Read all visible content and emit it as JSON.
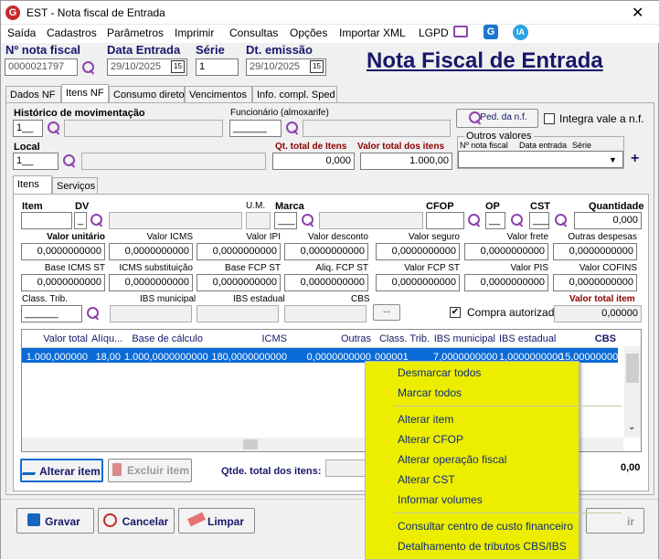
{
  "window": {
    "title": "EST - Nota fiscal de Entrada",
    "close": "✕"
  },
  "menu": {
    "items": [
      "Saída",
      "Cadastros",
      "Parâmetros",
      "Imprimir",
      "Consultas",
      "Opções",
      "Importar XML",
      "LGPD"
    ],
    "ia": "IA"
  },
  "header": {
    "nota_label": "Nº nota fiscal",
    "nota_value": "0000021797",
    "data_label": "Data Entrada",
    "data_value": "29/10/2025",
    "serie_label": "Série",
    "serie_value": "1",
    "emissao_label": "Dt. emissão",
    "emissao_value": "29/10/2025",
    "cal_icon": "15",
    "big_title": "Nota Fiscal de Entrada"
  },
  "tabs": [
    "Dados NF",
    "Itens NF",
    "Consumo direto",
    "Vencimentos",
    "Info. compl. Sped"
  ],
  "itens": {
    "historico_label": "Histórico de movimentação",
    "historico_value": "1__",
    "funcionario_label": "Funcionário (almoxarife)",
    "funcionario_value": "______",
    "ped_button": "Ped. da n.f.",
    "integra_label": "Integra vale a n.f.",
    "local_label": "Local",
    "local_value": "1__",
    "qt_label": "Qt. total de Itens",
    "qt_value": "0,000",
    "valor_total_label": "Valor total dos itens",
    "valor_total_value": "1.000,00",
    "outros_title": "Outros valores",
    "outros_cols": [
      "Nº nota fiscal",
      "Data entrada",
      "Série"
    ],
    "plus": "+"
  },
  "subtabs": [
    "Itens",
    "Serviços"
  ],
  "item_form": {
    "item_label": "Item",
    "dv_label": "DV",
    "dv_value": "_",
    "um_label": "U.M.",
    "marca_label": "Marca",
    "marca_value": "___",
    "cfop_label": "CFOP",
    "op_label": "OP",
    "op_value": "__",
    "cst_label": "CST",
    "cst_value": "___",
    "qtd_label": "Quantidade",
    "qtd_value": "0,000",
    "row2_labels": [
      "Valor unitário",
      "Valor ICMS",
      "Valor IPI",
      "Valor desconto",
      "Valor seguro",
      "Valor frete",
      "Outras despesas"
    ],
    "row2_values": [
      "0,0000000000",
      "0,0000000000",
      "0,0000000000",
      "0,0000000000",
      "0,0000000000",
      "0,0000000000",
      "0,0000000000"
    ],
    "row3_labels": [
      "Base ICMS ST",
      "ICMS substituição",
      "Base FCP ST",
      "Aliq. FCP ST",
      "Valor FCP ST",
      "Valor PIS",
      "Valor COFINS"
    ],
    "row3_values": [
      "0,0000000000",
      "0,0000000000",
      "0,0000000000",
      "0,0000000000",
      "0,0000000000",
      "0,0000000000",
      "0,0000000000"
    ],
    "class_label": "Class. Trib.",
    "class_value": "______",
    "ibs_mun_label": "IBS municipal",
    "ibs_est_label": "IBS estadual",
    "cbs_label": "CBS",
    "dots": "...",
    "compra_label": "Compra autorizada",
    "valor_item_label": "Valor total item",
    "valor_item_value": "0,00000"
  },
  "grid": {
    "headers": [
      "Valor total",
      "Alíqu...",
      "Base de cálculo",
      "ICMS",
      "Outras",
      "Class. Trib.",
      "IBS municipal",
      "IBS estadual",
      "CBS"
    ],
    "row": [
      "1.000,000000",
      "18,00",
      "1.000,0000000000",
      "180,0000000000",
      "0,0000000000",
      "000001",
      "7,0000000000",
      "1,0000000000",
      "15,0000000000"
    ]
  },
  "bottom": {
    "alterar": "Alterar item",
    "excluir": "Excluir item",
    "qtde_label": "Qtde. total dos itens:",
    "total_partial": "0,00"
  },
  "footer": {
    "gravar": "Gravar",
    "cancelar": "Cancelar",
    "limpar": "Limpar",
    "sair_partial": "ir"
  },
  "context_menu": [
    "Desmarcar todos",
    "Marcar todos",
    "Alterar item",
    "Alterar CFOP",
    "Alterar operação fiscal",
    "Alterar CST",
    "Informar volumes",
    "Consultar centro de custo financeiro",
    "Detalhamento de tributos CBS/IBS"
  ],
  "colors": {
    "accent": "#17176b",
    "ctx_bg": "#eded00",
    "selection": "#0a6bd6",
    "red_label": "#8b0000"
  }
}
